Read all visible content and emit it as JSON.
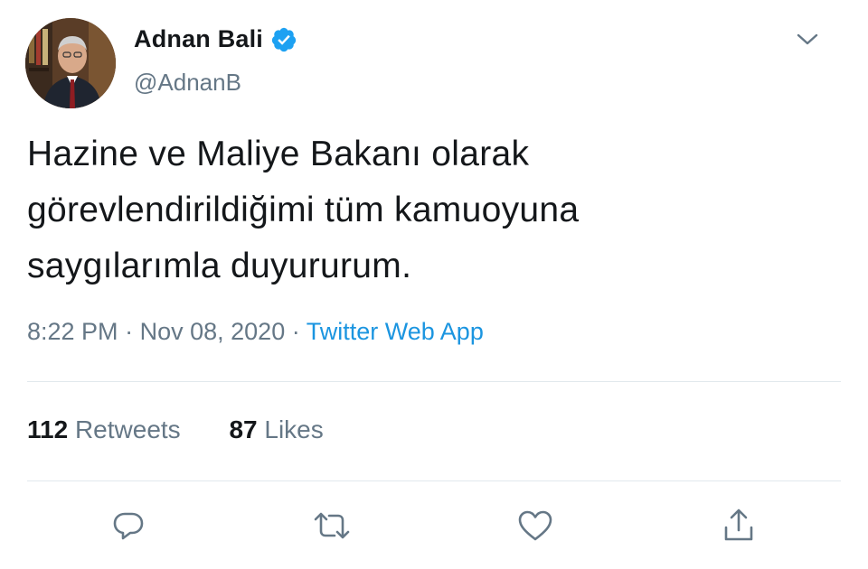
{
  "colors": {
    "text_primary": "#14171a",
    "text_secondary": "#657786",
    "link": "#1b95e0",
    "verified": "#1da1f2",
    "divider": "#e1e8ed"
  },
  "author": {
    "display_name": "Adnan Bali",
    "handle": "@AdnanB",
    "verified": true,
    "avatar_icon": "profile-photo"
  },
  "tweet": {
    "lines": [
      "Hazine ve Maliye Bakanı olarak",
      "görevlendirildiğimi tüm kamuoyuna",
      "saygılarımla duyururum."
    ],
    "time": "8:22 PM",
    "separator": "·",
    "date": "Nov 08, 2020",
    "source": "Twitter Web App"
  },
  "stats": {
    "retweets_count": "112",
    "retweets_label": "Retweets",
    "likes_count": "87",
    "likes_label": "Likes"
  },
  "actions": [
    {
      "icon": "reply-icon"
    },
    {
      "icon": "retweet-icon"
    },
    {
      "icon": "like-icon"
    },
    {
      "icon": "share-icon"
    }
  ]
}
